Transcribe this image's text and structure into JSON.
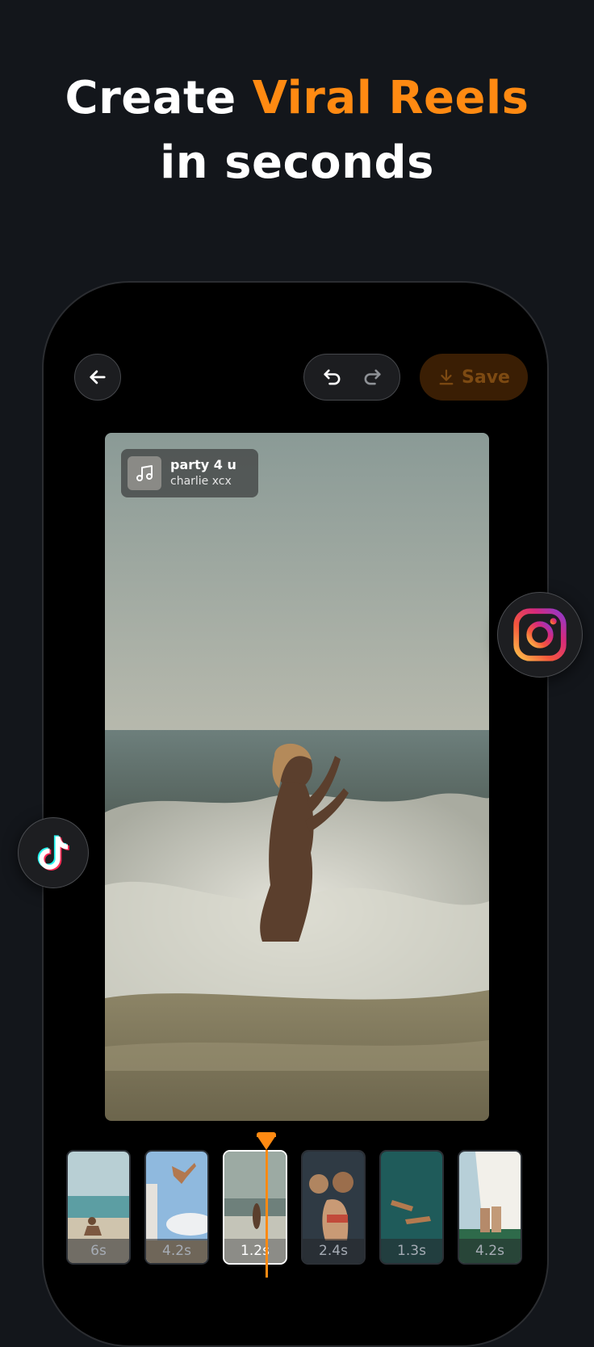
{
  "headline": {
    "line1_prefix": "Create",
    "line1_accent": "Viral Reels",
    "line2": "in seconds"
  },
  "colors": {
    "background": "#13161b",
    "accent": "#ff8a12",
    "save_bg": "#3a1e04"
  },
  "toolbar": {
    "back_icon": "arrow-left-icon",
    "undo_icon": "undo-icon",
    "redo_icon": "redo-icon",
    "save_label": "Save",
    "save_icon": "download-icon"
  },
  "preview": {
    "music": {
      "title": "party 4 u",
      "artist": "charlie xcx",
      "icon": "music-note-icon"
    }
  },
  "timeline": {
    "clips": [
      {
        "duration": "6s"
      },
      {
        "duration": "4.2s"
      },
      {
        "duration": "1.2s",
        "active": true
      },
      {
        "duration": "2.4s"
      },
      {
        "duration": "1.3s"
      },
      {
        "duration": "4.2s"
      }
    ]
  },
  "social_badges": [
    "instagram-icon",
    "tiktok-icon"
  ]
}
